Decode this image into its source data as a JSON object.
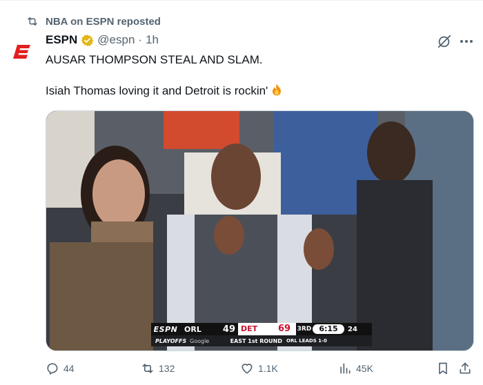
{
  "repost": {
    "label": "NBA on ESPN reposted",
    "icon": "repost-icon"
  },
  "author": {
    "avatar_icon": "espn-logo-icon",
    "name": "ESPN",
    "verified_icon": "verified-badge-icon",
    "handle": "@espn",
    "separator": "·",
    "time": "1h"
  },
  "tweet": {
    "line1": "AUSAR THOMPSON STEAL AND SLAM.",
    "line2": "Isiah Thomas loving it and Detroit is rockin'",
    "emoji_icon": "fire-emoji-icon"
  },
  "media": {
    "scorebug": {
      "network": "ESPN",
      "away_team": "ORL",
      "away_score": "49",
      "home_team": "DET",
      "home_score": "69",
      "quarter": "3RD",
      "clock": "6:15",
      "shot_clock": "24",
      "playoffs_label": "PLAYOFFS",
      "sponsor": "Google",
      "round": "EAST 1st ROUND",
      "series_status": "ORL LEADS 1-0"
    }
  },
  "actions": {
    "replies": "44",
    "reposts": "132",
    "likes": "1.1K",
    "views": "45K"
  },
  "colors": {
    "text": "#0f1419",
    "secondary": "#536471",
    "espn_red": "#e21e1e",
    "verified_gold": "#e2b719"
  }
}
